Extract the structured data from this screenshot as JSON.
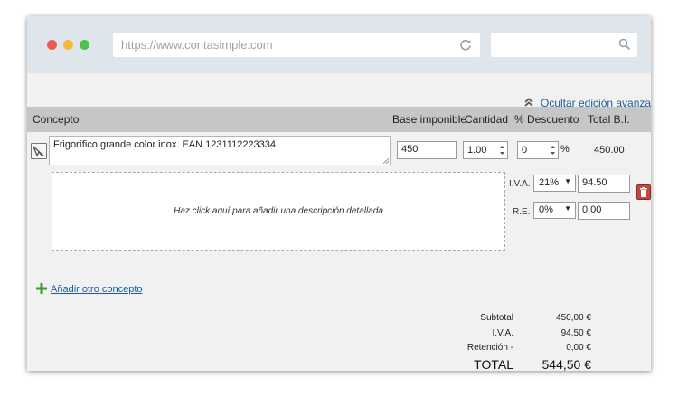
{
  "browser": {
    "url": "https://www.contasimple.com",
    "search_value": ""
  },
  "toolbar": {
    "advanced_toggle_label": "Ocultar edición avanzada"
  },
  "table": {
    "headers": {
      "concept": "Concepto",
      "base": "Base imponible",
      "quantity": "Cantidad",
      "discount": "% Descuento",
      "total": "Total B.I."
    }
  },
  "line": {
    "concept": "Frigorífico grande color inox. EAN 1231112223334",
    "base": "450",
    "quantity": "1.00",
    "discount": "0",
    "discount_unit": "%",
    "total": "450.00",
    "description_placeholder": "Haz click aquí para añadir una descripción detallada",
    "iva_label": "I.V.A.",
    "iva_rate": "21%",
    "iva_amount": "94.50",
    "re_label": "R.E.",
    "re_rate": "0%",
    "re_amount": "0.00"
  },
  "actions": {
    "add_concept": "Añadir otro concepto"
  },
  "summary": {
    "subtotal_label": "Subtotal",
    "subtotal": "450,00 €",
    "iva_label": "I.V.A.",
    "iva": "94,50 €",
    "retention_label": "Retención -",
    "retention": "0,00 €",
    "total_label": "TOTAL",
    "total": "544,50 €"
  },
  "colors": {
    "header_bg": "#c6c6c6",
    "link": "#1c5b9b",
    "trash": "#c9443f",
    "add_icon": "#3d9b35"
  }
}
